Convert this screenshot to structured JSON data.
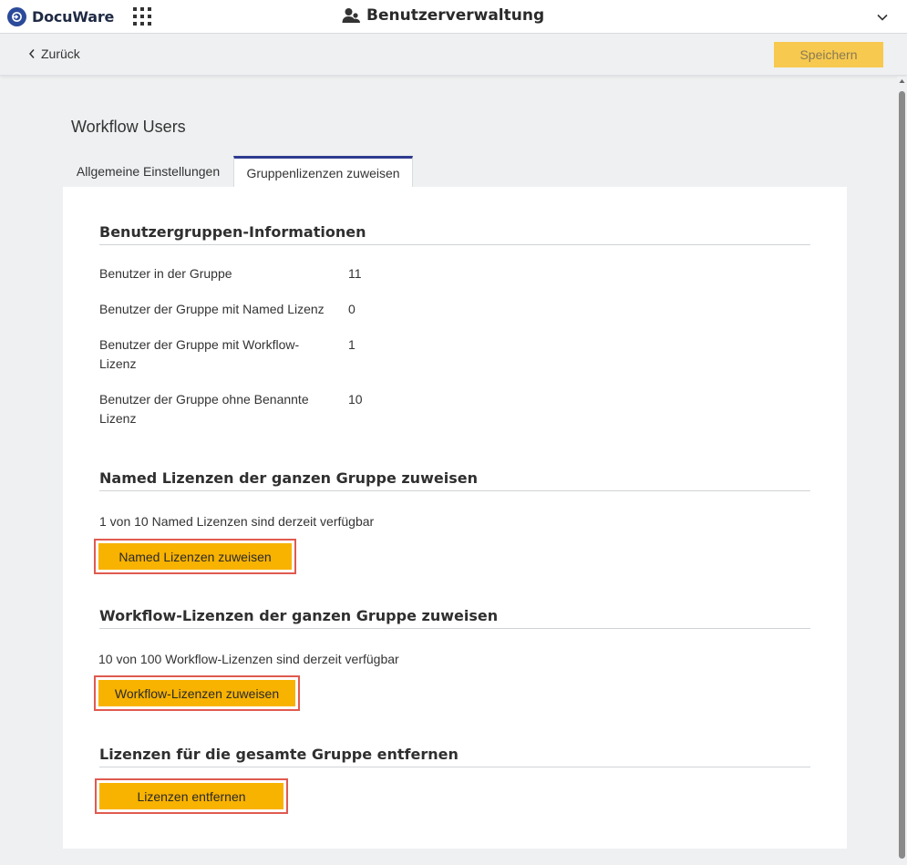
{
  "app": {
    "logo_text": "DocuWare",
    "title": "Benutzerverwaltung",
    "icons": {
      "apps": "grid-icon",
      "title": "users-icon",
      "menu": "chevron-down-icon",
      "back": "chevron-left-icon"
    }
  },
  "actionbar": {
    "back_label": "Zurück",
    "save_label": "Speichern"
  },
  "page": {
    "heading": "Workflow Users"
  },
  "tabs": [
    {
      "label": "Allgemeine Einstellungen",
      "active": false
    },
    {
      "label": "Gruppenlizenzen zuweisen",
      "active": true
    }
  ],
  "info": {
    "title": "Benutzergruppen-Informationen",
    "rows": [
      {
        "label": "Benutzer in der Gruppe",
        "value": "11"
      },
      {
        "label": "Benutzer der Gruppe mit Named Lizenz",
        "value": "0"
      },
      {
        "label": "Benutzer der Gruppe mit Workflow-Lizenz",
        "value": "1"
      },
      {
        "label": "Benutzer der Gruppe ohne Benannte Lizenz",
        "value": "10"
      }
    ]
  },
  "named": {
    "title": "Named Lizenzen der ganzen Gruppe zuweisen",
    "available": "1 von 10 Named Lizenzen sind derzeit verfügbar",
    "button": "Named Lizenzen zuweisen"
  },
  "workflow": {
    "title": "Workflow-Lizenzen der ganzen Gruppe zuweisen",
    "available": "10 von  100 Workflow-Lizenzen sind derzeit verfügbar",
    "button": "Workflow-Lizenzen zuweisen"
  },
  "remove": {
    "title": "Lizenzen für die gesamte Gruppe entfernen",
    "button": "Lizenzen entfernen"
  },
  "colors": {
    "accent": "#f8b200",
    "tab_active": "#2e3b8f",
    "highlight": "#e05a4f",
    "logo": "#2b4a9a"
  }
}
